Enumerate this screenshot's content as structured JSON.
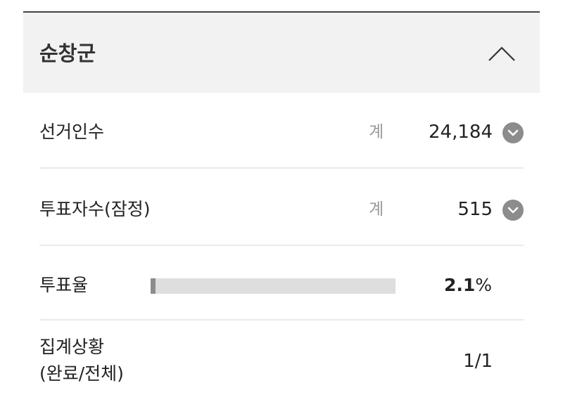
{
  "region": {
    "title": "순창군"
  },
  "rows": {
    "electorate": {
      "label": "선거인수",
      "sub": "계",
      "value": "24,184"
    },
    "voters": {
      "label": "투표자수(잠정)",
      "sub": "계",
      "value": "515"
    },
    "turnout": {
      "label": "투표율",
      "value": "2.1",
      "unit": "%",
      "fill_percent": 2.1
    },
    "count_status": {
      "label_line1": "집계상황",
      "label_line2": "(완료/전체)",
      "value": "1/1"
    }
  },
  "icons": {
    "collapse": "chevron-up-icon",
    "expand": "chevron-down-icon"
  },
  "colors": {
    "header_bg": "#f2f2f2",
    "header_border": "#444444",
    "bar_track": "#dedede",
    "bar_fill": "#8c8c8c",
    "expand_button": "#8c8c8c"
  }
}
